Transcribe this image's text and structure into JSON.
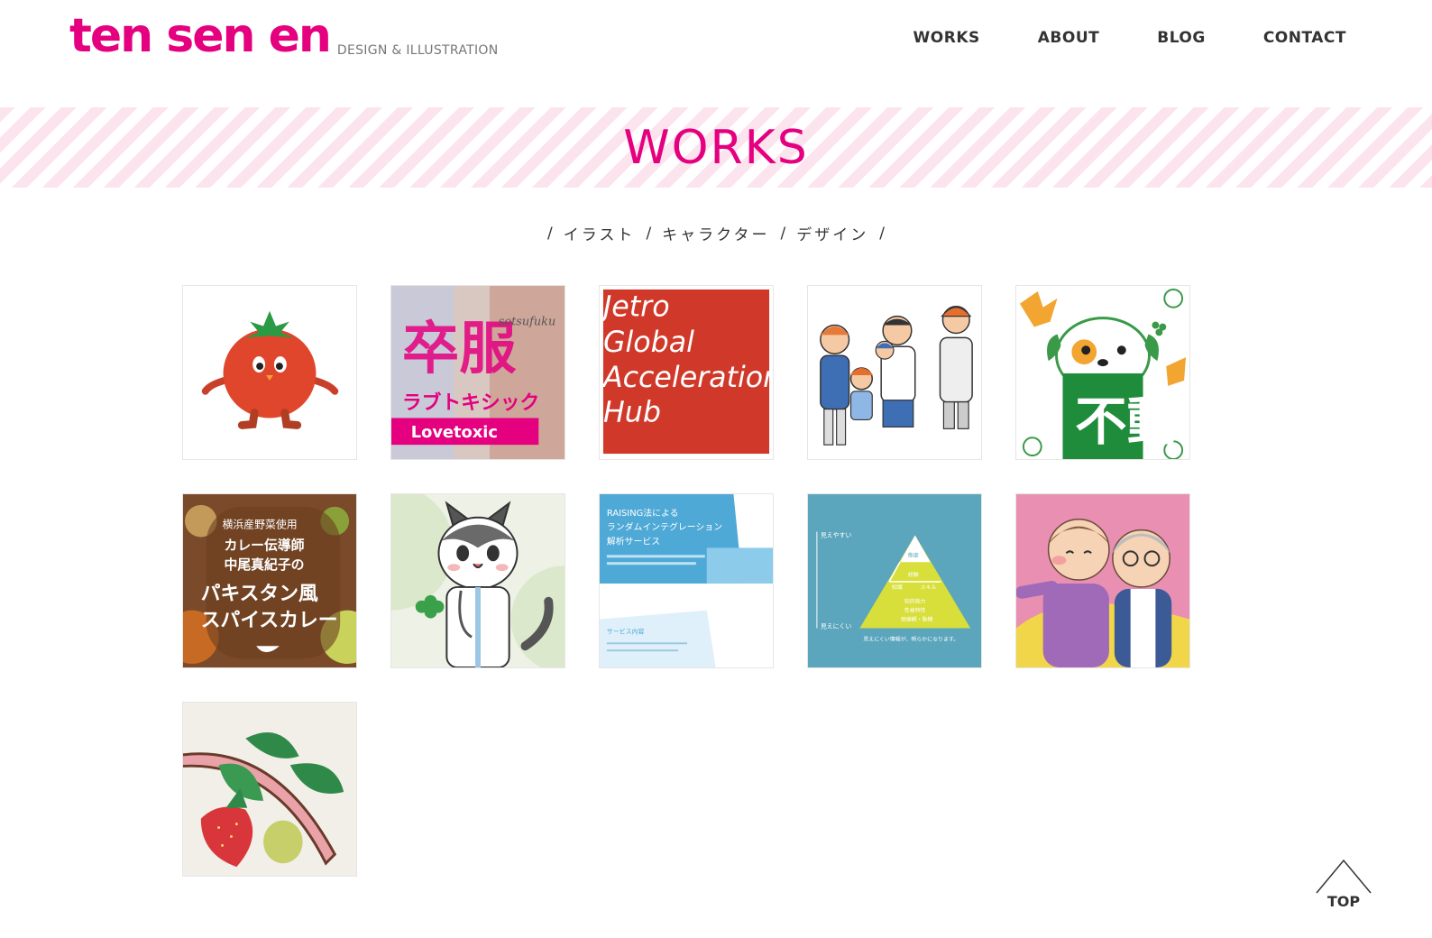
{
  "header": {
    "logo_text": "ten sen en",
    "logo_sub": "DESIGN & ILLUSTRATION",
    "nav": [
      "WORKS",
      "ABOUT",
      "BLOG",
      "CONTACT"
    ]
  },
  "page_title": "WORKS",
  "filters": {
    "separator": "/",
    "items": [
      "イラスト",
      "キャラクター",
      "デザイン"
    ]
  },
  "works": [
    {
      "subject": "tomato-character"
    },
    {
      "subject": "sotsufuku-lovetoxic",
      "text_main": "卒服",
      "text_sub": "ラブトキシック",
      "text_brand": "Lovetoxic",
      "text_script": "sotsufuku"
    },
    {
      "subject": "jetro-poster",
      "lines": [
        "Jetro",
        "Global",
        "Acceleration",
        "Hub"
      ]
    },
    {
      "subject": "family-evacuation"
    },
    {
      "subject": "dog-autumn",
      "text_main": "不動"
    },
    {
      "subject": "curry-recipe",
      "lines": [
        "横浜産野菜使用",
        "カレー伝導師",
        "中尾真紀子の",
        "パキスタン風",
        "スパイスカレー"
      ]
    },
    {
      "subject": "cat-doctor"
    },
    {
      "subject": "raising-brochure",
      "lines": [
        "RAISING法による",
        "ランダムインテグレーション",
        "解析サービス"
      ],
      "footer": "サービス内容"
    },
    {
      "subject": "pyramid-diagram",
      "top_left": "見えやすい",
      "bottom_left": "見えにくい",
      "caption": "見えにくい情報が、明らかになります。",
      "levels": [
        "態度",
        "経験",
        "知識",
        "スキル",
        "知的能力",
        "性格特性",
        "価値観・動機"
      ]
    },
    {
      "subject": "elderly-couple"
    },
    {
      "subject": "strawberry-illustration"
    }
  ],
  "top_button": "TOP",
  "colors": {
    "brand": "#e4007f",
    "stripe": "#fce4ef",
    "nav_text": "#333333"
  }
}
